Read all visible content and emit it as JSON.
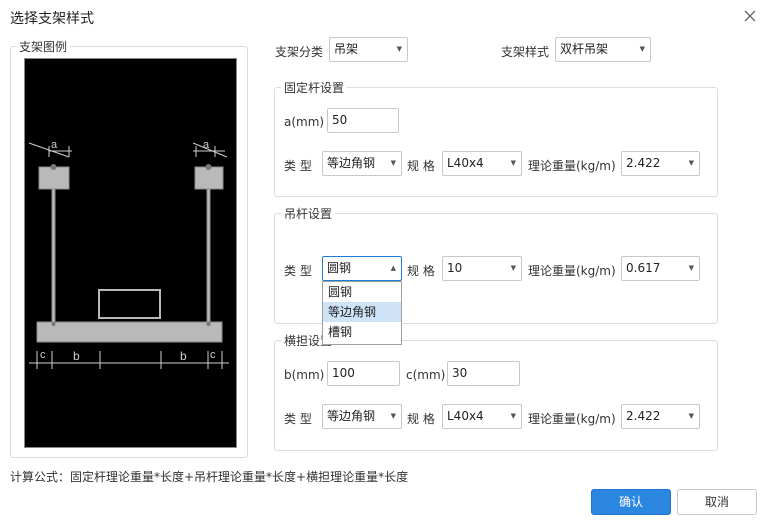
{
  "dialog": {
    "title": "选择支架样式",
    "formula": "计算公式：固定杆理论重量*长度+吊杆理论重量*长度+横担理论重量*长度",
    "ok_label": "确认",
    "cancel_label": "取消"
  },
  "preview": {
    "title": "支架图例",
    "dim_labels": {
      "a": "a",
      "b": "b",
      "c": "c"
    }
  },
  "top": {
    "category_label": "支架分类",
    "category_value": "吊架",
    "style_label": "支架样式",
    "style_value": "双杆吊架"
  },
  "fixed_rod": {
    "title": "固定杆设置",
    "a_label": "a(mm)",
    "a_value": "50",
    "type_label": "类  型",
    "type_value": "等边角钢",
    "spec_label": "规 格",
    "spec_value": "L40x4",
    "weight_label": "理论重量(kg/m)",
    "weight_value": "2.422"
  },
  "hanger_rod": {
    "title": "吊杆设置",
    "type_label": "类  型",
    "type_value": "圆钢",
    "spec_label": "规 格",
    "spec_value": "10",
    "weight_label": "理论重量(kg/m)",
    "weight_value": "0.617",
    "type_options": [
      "圆钢",
      "等边角钢",
      "槽钢"
    ],
    "type_highlighted": "等边角钢"
  },
  "crossbar": {
    "title": "横担设置",
    "b_label": "b(mm)",
    "b_value": "100",
    "c_label": "c(mm)",
    "c_value": "30",
    "type_label": "类  型",
    "type_value": "等边角钢",
    "spec_label": "规 格",
    "spec_value": "L40x4",
    "weight_label": "理论重量(kg/m)",
    "weight_value": "2.422"
  },
  "colors": {
    "accent": "#2b86e0",
    "highlight": "#cfe3f8",
    "preview_bg": "#000000"
  }
}
